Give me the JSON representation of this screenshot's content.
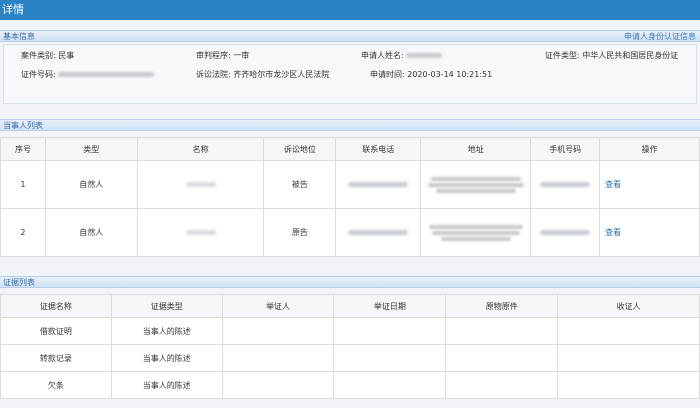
{
  "window": {
    "title": "详情"
  },
  "basic_info": {
    "header": "基本信息",
    "link_label": "申请人身份认证信息",
    "case_type_label": "案件类别:",
    "case_type_value": "民事",
    "trial_procedure_label": "审判程序:",
    "trial_procedure_value": "一审",
    "applicant_name_label": "申请人姓名:",
    "id_type_label": "证件类型:",
    "id_type_value": "中华人民共和国居民身份证",
    "id_number_label": "证件号码:",
    "court_label": "诉讼法院:",
    "court_value": "齐齐哈尔市龙沙区人民法院",
    "apply_time_label": "申请时间:",
    "apply_time_value": "2020-03-14 10:21:51"
  },
  "parties": {
    "header": "当事人列表",
    "columns": [
      "序号",
      "类型",
      "名称",
      "诉讼地位",
      "联系电话",
      "地址",
      "手机号码",
      "操作"
    ],
    "rows": [
      {
        "index": "1",
        "type": "自然人",
        "role": "被告",
        "action": "查看"
      },
      {
        "index": "2",
        "type": "自然人",
        "role": "原告",
        "action": "查看"
      }
    ]
  },
  "evidence": {
    "header": "证据列表",
    "columns": [
      "证据名称",
      "证据类型",
      "举证人",
      "举证日期",
      "原物原件",
      "收证人"
    ],
    "rows": [
      {
        "name": "借款证明",
        "type": "当事人的陈述"
      },
      {
        "name": "转款记录",
        "type": "当事人的陈述"
      },
      {
        "name": "欠条",
        "type": "当事人的陈述"
      }
    ]
  }
}
